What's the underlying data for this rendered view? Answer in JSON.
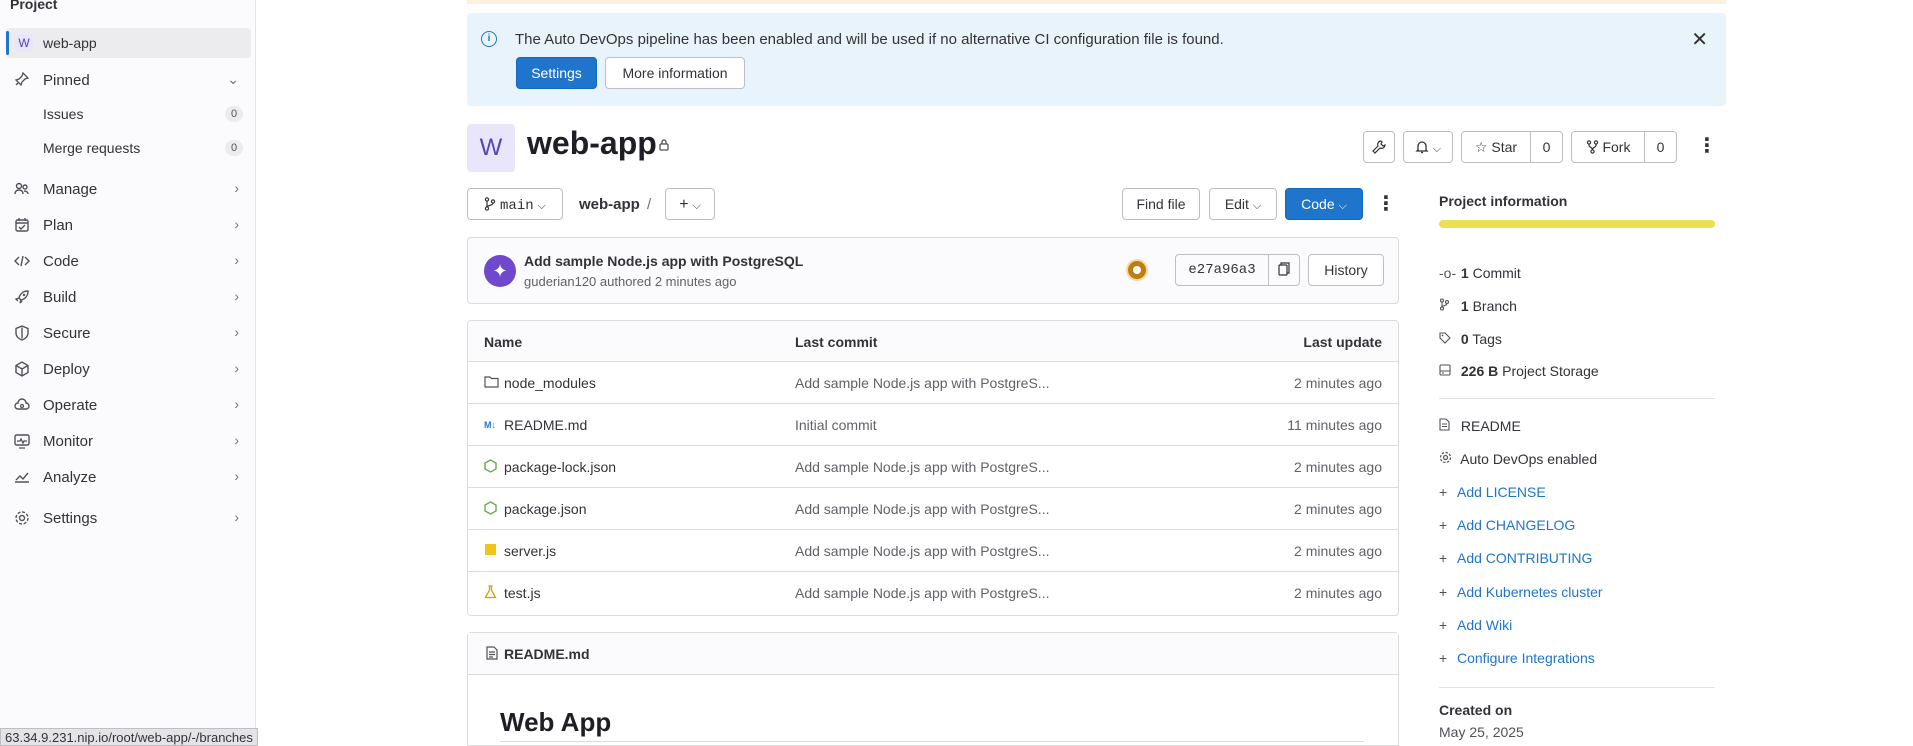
{
  "sidebar": {
    "header": "Project",
    "project": {
      "avatar": "W",
      "name": "web-app"
    },
    "pinned": "Pinned",
    "pinned_items": [
      {
        "label": "Issues",
        "count": "0"
      },
      {
        "label": "Merge requests",
        "count": "0"
      }
    ],
    "items": [
      {
        "label": "Manage",
        "icon": "users-icon"
      },
      {
        "label": "Plan",
        "icon": "planning-icon"
      },
      {
        "label": "Code",
        "icon": "code-icon"
      },
      {
        "label": "Build",
        "icon": "rocket-icon"
      },
      {
        "label": "Secure",
        "icon": "shield-icon"
      },
      {
        "label": "Deploy",
        "icon": "deploy-icon"
      },
      {
        "label": "Operate",
        "icon": "cloud-gear-icon"
      },
      {
        "label": "Monitor",
        "icon": "monitor-icon"
      },
      {
        "label": "Analyze",
        "icon": "chart-icon"
      },
      {
        "label": "Settings",
        "icon": "gear-icon"
      }
    ]
  },
  "status_url": "63.34.9.231.nip.io/root/web-app/-/branches",
  "alert": {
    "message": "The Auto DevOps pipeline has been enabled and will be used if no alternative CI configuration file is found.",
    "settings_btn": "Settings",
    "more_btn": "More information"
  },
  "project": {
    "avatar": "W",
    "title": "web-app",
    "star_label": "Star",
    "star_count": "0",
    "fork_label": "Fork",
    "fork_count": "0"
  },
  "repo": {
    "branch": "main",
    "path": "web-app",
    "separator": "/",
    "find_file": "Find file",
    "edit": "Edit",
    "code": "Code"
  },
  "commit": {
    "title": "Add sample Node.js app with PostgreSQL",
    "subtitle": "guderian120 authored 2 minutes ago",
    "sha": "e27a96a3",
    "history": "History"
  },
  "files": {
    "headers": {
      "name": "Name",
      "last_commit": "Last commit",
      "last_update": "Last update"
    },
    "rows": [
      {
        "name": "node_modules",
        "commit": "Add sample Node.js app with PostgreS...",
        "updated": "2 minutes ago",
        "icon": "folder-icon"
      },
      {
        "name": "README.md",
        "commit": "Initial commit",
        "updated": "11 minutes ago",
        "icon": "markdown-icon"
      },
      {
        "name": "package-lock.json",
        "commit": "Add sample Node.js app with PostgreS...",
        "updated": "2 minutes ago",
        "icon": "node-icon"
      },
      {
        "name": "package.json",
        "commit": "Add sample Node.js app with PostgreS...",
        "updated": "2 minutes ago",
        "icon": "node-icon"
      },
      {
        "name": "server.js",
        "commit": "Add sample Node.js app with PostgreS...",
        "updated": "2 minutes ago",
        "icon": "js-icon"
      },
      {
        "name": "test.js",
        "commit": "Add sample Node.js app with PostgreS...",
        "updated": "2 minutes ago",
        "icon": "test-icon"
      }
    ]
  },
  "readme": {
    "filename": "README.md",
    "heading": "Web App"
  },
  "info": {
    "title": "Project information",
    "commits_num": "1",
    "commits_label": "Commit",
    "branches_num": "1",
    "branches_label": "Branch",
    "tags_num": "0",
    "tags_label": "Tags",
    "storage_num": "226 B",
    "storage_label": "Project Storage",
    "readme": "README",
    "autodevops": "Auto DevOps enabled",
    "links": [
      "Add LICENSE",
      "Add CHANGELOG",
      "Add CONTRIBUTING",
      "Add Kubernetes cluster",
      "Add Wiki",
      "Configure Integrations"
    ],
    "created_label": "Created on",
    "created_date": "May 25, 2025"
  },
  "colors": {
    "accent": "#1f75cb",
    "alert_bg": "#e9f3fc",
    "progress": "#e9e155"
  }
}
